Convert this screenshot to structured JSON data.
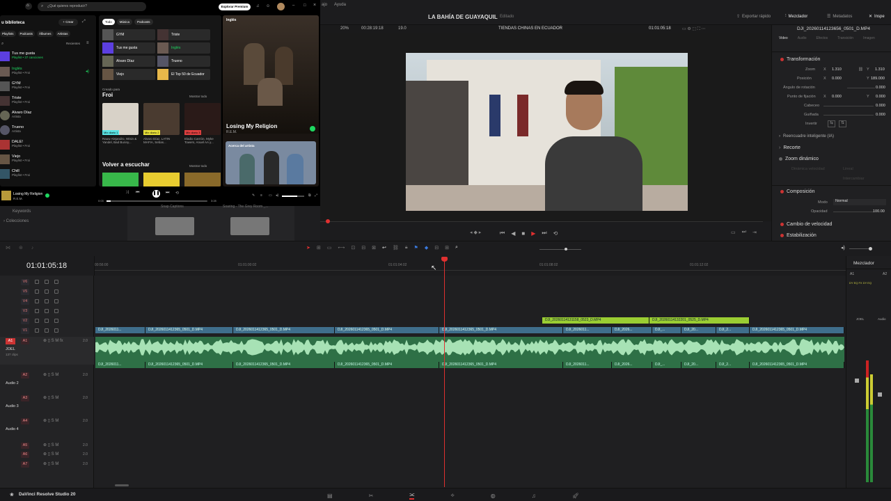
{
  "spotify": {
    "search_placeholder": "¿Qué quieres reproducir?",
    "premium": "Explorar Premium",
    "library_title": "u biblioteca",
    "create": "+ Crear",
    "chips": [
      "Playlists",
      "Podcasts",
      "Álbumes",
      "Artistas"
    ],
    "recents": "Recientes",
    "library": [
      {
        "name": "Tus me gusta",
        "sub": "Playlist • 37 canciones"
      },
      {
        "name": "Inglés",
        "sub": "Playlist • Froi"
      },
      {
        "name": "GYM",
        "sub": "Playlist • Froi"
      },
      {
        "name": "Triste",
        "sub": "Playlist • Froi"
      },
      {
        "name": "Alvaro Díaz",
        "sub": "Artista"
      },
      {
        "name": "Trueno",
        "sub": "Artista"
      },
      {
        "name": "DALE!",
        "sub": "Playlist • Froi"
      },
      {
        "name": "Viejo",
        "sub": "Playlist • Froi"
      },
      {
        "name": "Chill",
        "sub": "Playlist • Froi"
      }
    ],
    "filters": [
      "Todo",
      "Música",
      "Podcasts"
    ],
    "tiles": [
      "GYM",
      "Triste",
      "Tus me gusta",
      "Inglés",
      "Alvaro Díaz",
      "Trueno",
      "Viejo",
      "El Top 50 de Ecuador"
    ],
    "creado_para": "Creado para",
    "section_froi": "Froi",
    "show_all": "Mostrar todo",
    "mixes": [
      {
        "label": "Mix diario 1",
        "sub": "Rauw Alejandro, Wisin & Yandel, Bad Bunny..."
      },
      {
        "label": "Mix diario 2",
        "sub": "Alvaro Díaz, LATIN MAFIA, Sebas..."
      },
      {
        "label": "Mix diario 3",
        "sub": "Eladio Carrión, Myke Towers, Anuel AA y..."
      }
    ],
    "volver": "Volver a escuchar",
    "show_all_2": "Mostrar todo",
    "now_playing_panel": "Inglés",
    "np_title": "Losing My Religion",
    "np_artist": "R.E.M.",
    "about_artist": "Acerca del artista",
    "player_title": "Losing My Religion",
    "player_artist": "R.E.M.",
    "time_start": "0:03",
    "time_end": "3:28"
  },
  "resolve": {
    "menu": [
      "ajo",
      "Ayuda"
    ],
    "project_title": "LA BAHÍA DE GUAYAQUIL",
    "project_status": "Editado",
    "export": "Exportar rápido",
    "mixer": "Mezclador",
    "metadata": "Metadatos",
    "inspector": "Inspe",
    "zoom_level": "20%",
    "timecode_src": "00:28:19:18",
    "fps": "19.0",
    "timeline_name": "TIENDAS CHINAS EN ECUADOR",
    "timecode": "01:01:05:18",
    "clip_name": "DJI_20260114123656_0501_D.MP4",
    "insp_tabs": [
      "Video",
      "Audio",
      "Efectos",
      "Transición",
      "Imagen"
    ],
    "transform": "Transformación",
    "zoom_label": "Zoom",
    "zoom_x": "1.310",
    "zoom_y": "1.310",
    "pos_label": "Posición",
    "pos_x": "0.000",
    "pos_y": "189.000",
    "rot_label": "Ángulo de rotación",
    "rot_val": "0.000",
    "anchor_label": "Punto de fijación",
    "anchor_x": "0.000",
    "anchor_y": "0.000",
    "pitch_label": "Cabeceo",
    "pitch_val": "0.000",
    "yaw_label": "Guiñada",
    "yaw_val": "0.000",
    "flip_label": "Invertir",
    "smart_reframe": "Reencuadre inteligente (IA)",
    "crop": "Recorte",
    "dyn_zoom": "Zoom dinámico",
    "dyn_ease": "Dinámica velocidad",
    "dyn_ease_val": "Lineal",
    "dyn_swap": "Intercambiar",
    "composite": "Composición",
    "mode_label": "Modo",
    "mode_val": "Normal",
    "opacity_label": "Opacidad",
    "opacity_val": "100.00",
    "speed_change": "Cambio de velocidad",
    "stabilization": "Estabilización",
    "keywords": "Keywords",
    "collections": "Colecciones",
    "pool_clips": [
      "Snap Captions",
      "Soaring - The Grey Room _..."
    ],
    "tl_timecode": "01:01:05:18",
    "ruler": [
      "00:56:00",
      "01:01:00:02",
      "01:01:04:02",
      "01:01:08:02",
      "01:01:12:02"
    ],
    "tracks_video": [
      "V6",
      "V5",
      "V4",
      "V3",
      "V2",
      "V1"
    ],
    "a1_name": "JOEL",
    "a1_clips": "137 clips",
    "a1": "A1",
    "a2": "A2",
    "a2_name": "Audio 2",
    "a3": "A3",
    "a3_name": "Audio 3",
    "a4": "A4",
    "a4_name": "Audio 4",
    "a5": "A5",
    "a6": "A6",
    "a7": "A7",
    "vol": "2.0",
    "clip_short": "DJI_2026011412365_0501_D.MP4",
    "clip_trunc1": "DJI_2026011...",
    "clip_trunc2": "DJI_2026...",
    "clip_trunc3": "DJI_...",
    "clip_trunc4": "DJI_20...",
    "clip_trunc5": "DJI_2...",
    "v2_clip1": "DJI_20260114131158_0523_D.MP4",
    "v2_clip2": "DJI_20260114132201_0525_D.MP4",
    "mixer_title": "Mezclador",
    "mixer_a1": "A1",
    "mixer_a2": "A2",
    "mixer_joel": "JOEL",
    "mixer_audio": "Audio",
    "app_name": "DaVinci Resolve Studio 20",
    "colors": {
      "accent_red": "#e03030",
      "clip_blue": "#3f6e8c",
      "clip_green": "#2e7046",
      "clip_lime": "#9acd32",
      "spotify_green": "#1ed760"
    }
  }
}
